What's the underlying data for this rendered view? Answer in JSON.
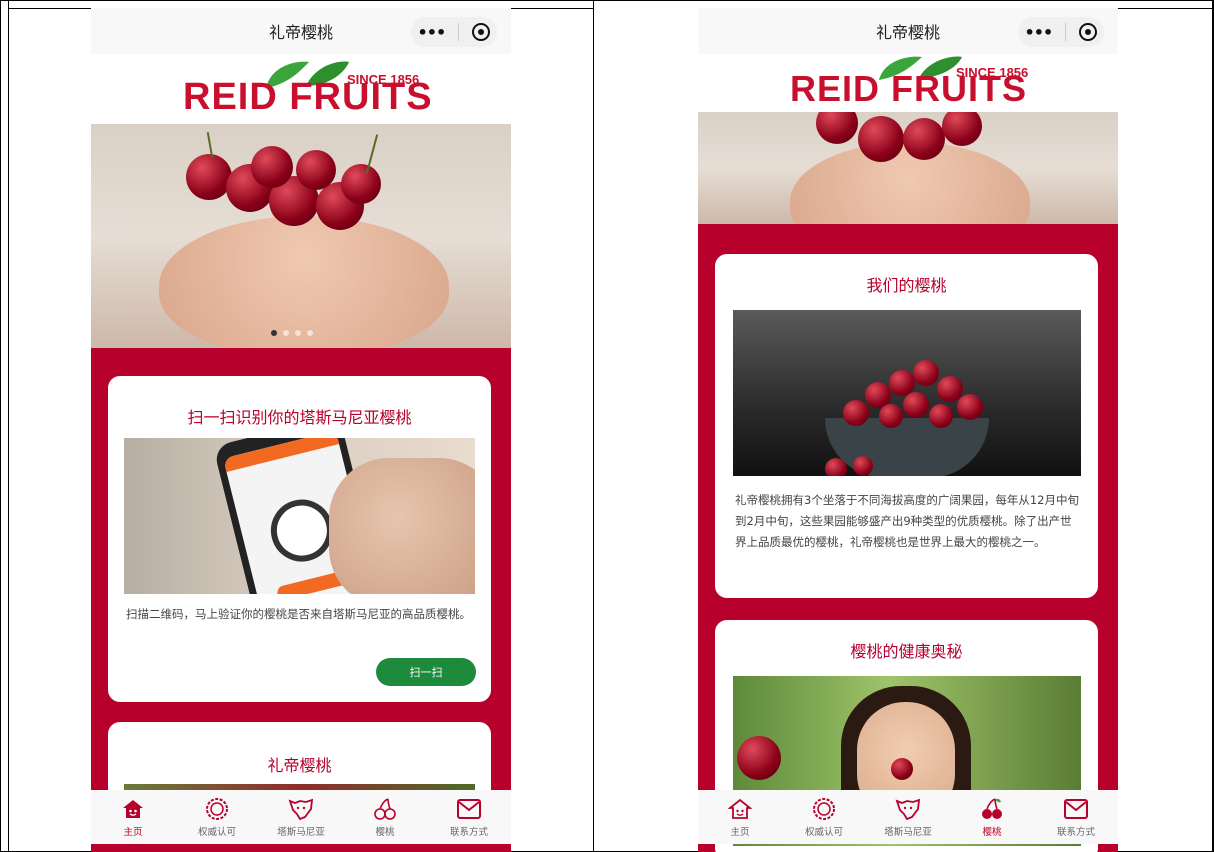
{
  "app_title": "礼帝樱桃",
  "logo": {
    "brand": "REID FRUITS",
    "since": "SINCE 1856"
  },
  "colors": {
    "brand": "#b8002d",
    "button": "#1d8a3c"
  },
  "left": {
    "card1": {
      "title": "扫一扫识别你的塔斯马尼亚樱桃",
      "text": "扫描二维码，马上验证你的樱桃是否来自塔斯马尼亚的高品质樱桃。",
      "button": "扫一扫"
    },
    "card2": {
      "title": "礼帝樱桃"
    },
    "carousel_active_index": 0,
    "carousel_count": 4
  },
  "right": {
    "card1": {
      "title": "我们的樱桃",
      "text": "礼帝樱桃拥有3个坐落于不同海拔高度的广阔果园，每年从12月中旬到2月中旬，这些果园能够盛产出9种类型的优质樱桃。除了出产世界上品质最优的樱桃，礼帝樱桃也是世界上最大的樱桃之一。"
    },
    "card2": {
      "title": "樱桃的健康奥秘"
    }
  },
  "tabbar": {
    "items": [
      {
        "label": "主页",
        "icon": "home-icon"
      },
      {
        "label": "权威认可",
        "icon": "badge-icon"
      },
      {
        "label": "塔斯马尼亚",
        "icon": "tasmania-map-icon"
      },
      {
        "label": "樱桃",
        "icon": "cherry-icon"
      },
      {
        "label": "联系方式",
        "icon": "mail-icon"
      }
    ],
    "left_active": "主页",
    "right_active": "樱桃"
  }
}
